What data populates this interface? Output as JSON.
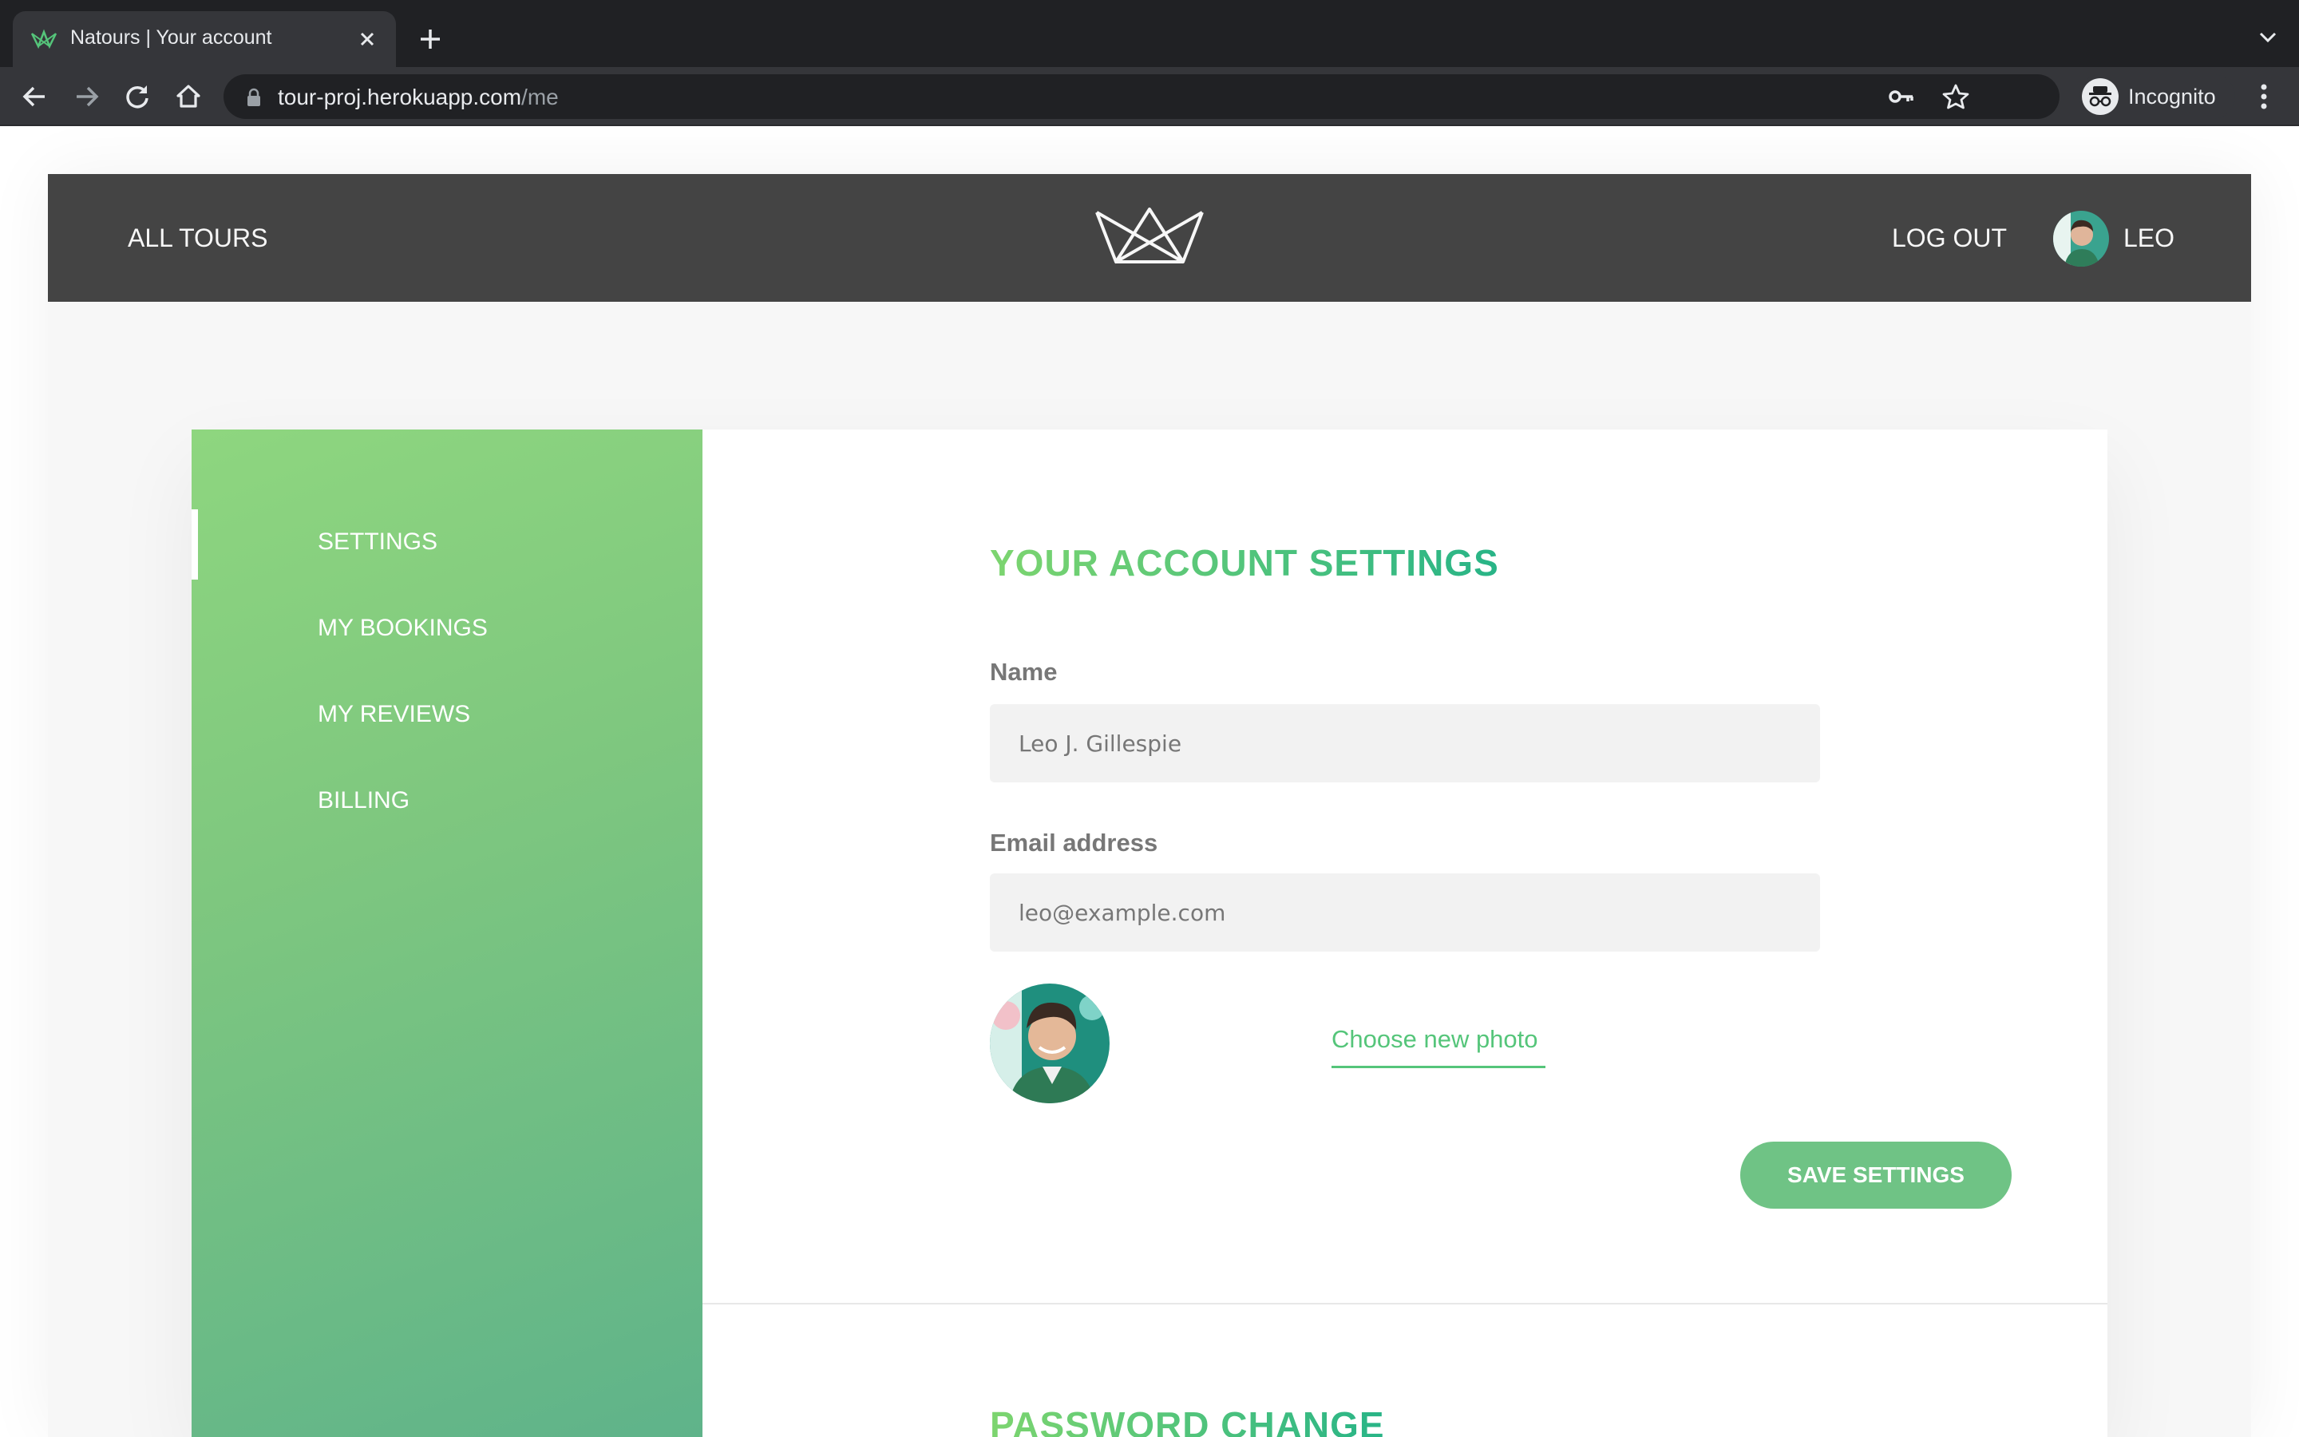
{
  "browser": {
    "tab_title": "Natours | Your account",
    "url_host": "tour-proj.herokuapp.com",
    "url_path": "/me",
    "profile_label": "Incognito"
  },
  "header": {
    "all_tours": "ALL TOURS",
    "logout": "LOG OUT",
    "user_name": "LEO"
  },
  "sidebar": {
    "items": [
      {
        "label": "SETTINGS",
        "active": true
      },
      {
        "label": "MY BOOKINGS"
      },
      {
        "label": "MY REVIEWS"
      },
      {
        "label": "BILLING"
      }
    ]
  },
  "settings": {
    "title": "YOUR ACCOUNT SETTINGS",
    "name_label": "Name",
    "name_value": "Leo J. Gillespie",
    "email_label": "Email address",
    "email_value": "leo@example.com",
    "photo_link": "Choose new photo",
    "save_button": "SAVE SETTINGS"
  },
  "password": {
    "title": "PASSWORD CHANGE"
  },
  "colors": {
    "accent": "#55c57a",
    "accent_light": "#7dd56f",
    "accent_dark": "#28b487",
    "header_bg": "#444444",
    "chrome_bg": "#202124"
  }
}
